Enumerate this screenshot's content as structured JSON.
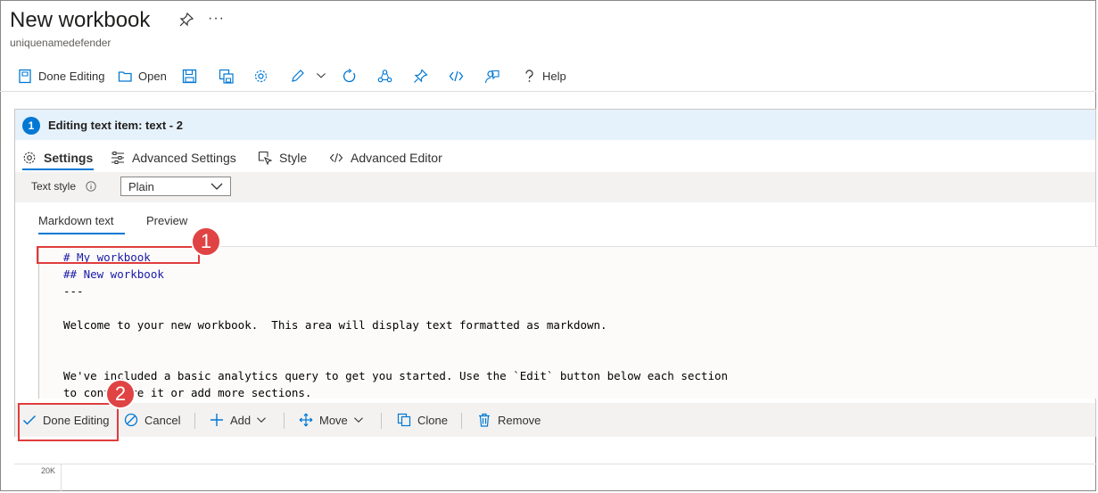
{
  "header": {
    "title": "New workbook",
    "subtitle": "uniquenamedefender",
    "more": "···"
  },
  "toolbar": {
    "done_editing": "Done Editing",
    "open": "Open",
    "help": "Help"
  },
  "panel": {
    "step_number": "1",
    "title": "Editing text item: text - 2",
    "tabs": [
      "Settings",
      "Advanced Settings",
      "Style",
      "Advanced Editor"
    ],
    "text_style_label": "Text style",
    "text_style_value": "Plain",
    "subtabs": [
      "Markdown text",
      "Preview"
    ],
    "editor_lines": [
      "# My workbook",
      "## New workbook",
      "---",
      "",
      "Welcome to your new workbook.  This area will display text formatted as markdown.",
      "",
      "",
      "We've included a basic analytics query to get you started. Use the `Edit` button below each section",
      "to configure it or add more sections."
    ]
  },
  "actions": {
    "done_editing": "Done Editing",
    "cancel": "Cancel",
    "add": "Add",
    "move": "Move",
    "clone": "Clone",
    "remove": "Remove"
  },
  "callouts": {
    "first": "1",
    "second": "2"
  },
  "chart": {
    "tick_label": "20K"
  },
  "colors": {
    "accent": "#0078d4",
    "callout": "#e04343",
    "panel_header": "#e6f2fb"
  }
}
